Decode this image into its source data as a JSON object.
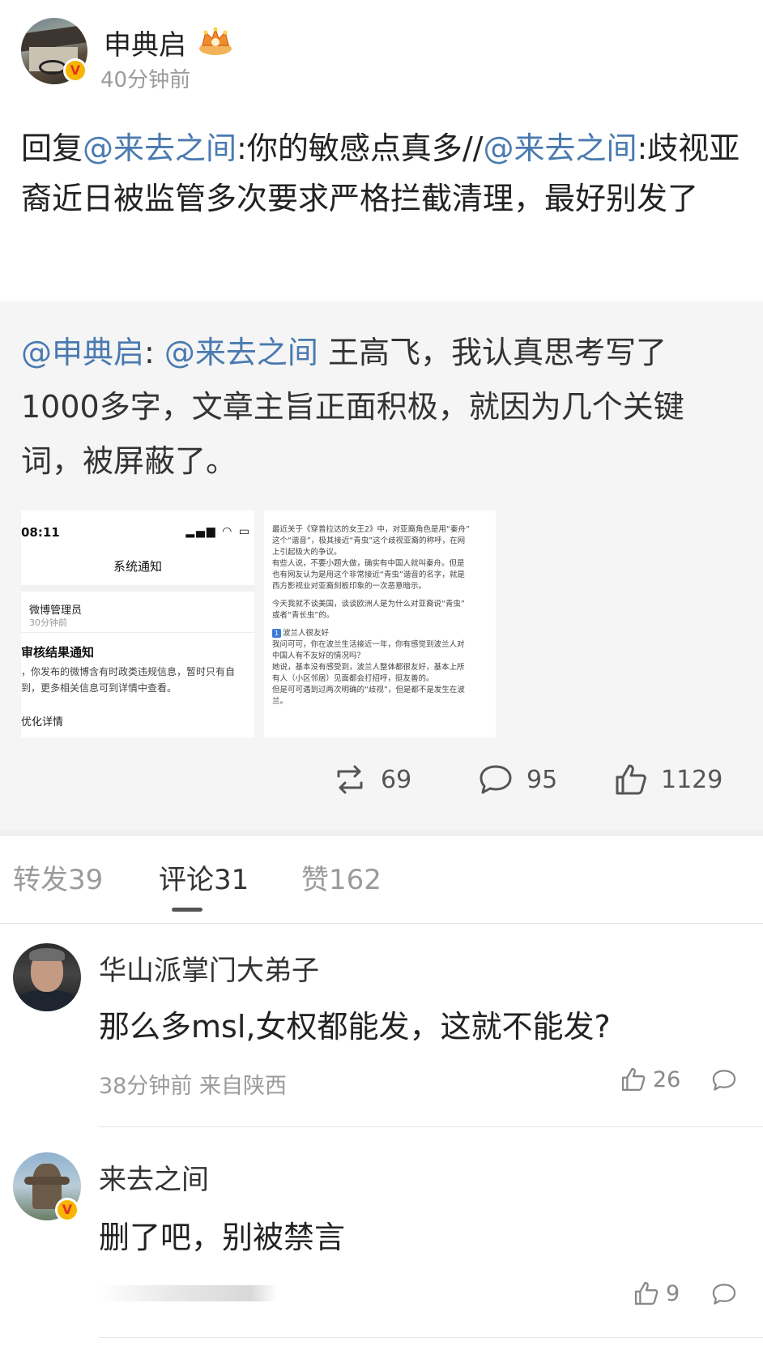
{
  "post": {
    "author": "申典启",
    "time": "40分钟前",
    "text": {
      "prefix": "回复",
      "mention1": "@来去之间",
      "mid": ":你的敏感点真多//",
      "mention2": "@来去之间",
      "rest": ":歧视亚裔近日被监管多次要求严格拦截清理，最好别发了"
    }
  },
  "repost": {
    "mention_author": "@申典启",
    "colon": ": ",
    "mention_target": "@来去之间",
    "text": " 王高飞，我认真思考写了1000多字，文章主旨正面积极，就因为几个关键词，被屏蔽了。",
    "thumb1": {
      "status_time": "08:11",
      "title": "系统通知",
      "admin_name": "微博管理员",
      "admin_time": "30分钟前",
      "result_title": "审核结果通知",
      "line1": "，你发布的微博含有时政类违规信息，暂时只有自",
      "line2": "到，更多相关信息可到详情中查看。",
      "optimize": "优化详情"
    },
    "thumb2": {
      "lines": [
        "最近关于《穿普拉达的女王2》中，对亚裔角色是用“秦舟”",
        "这个“谐音”，极其接近“青虫”这个歧视亚裔的称呼，在网",
        "上引起极大的争议。",
        "有些人说，不要小题大做，确实有中国人就叫秦舟。但是",
        "也有网友认为是用这个非常接近“青虫”谐音的名字，就是",
        "西方影视业对亚裔刻板印象的一次恶意暗示。",
        "",
        "今天我就不谈美国，谈谈欧洲人是为什么对亚裔说“青虫”",
        "或者“青长虫”的。",
        "",
        "波兰人很友好",
        "我问可可，你在波兰生活接近一年，你有感觉到波兰人对",
        "中国人有不友好的情况吗？",
        "她说，基本没有感受到，波兰人整体都很友好，基本上所",
        "有人（小区邻居）见面都会打招呼，挺友善的。",
        "但是可可遇到过两次明确的“歧视”，但是都不是发生在波",
        "兰。"
      ]
    },
    "reposts": "69",
    "comments": "95",
    "likes": "1129"
  },
  "tabs": {
    "forward": "转发39",
    "comments": "评论31",
    "likes": "赞162"
  },
  "comments": [
    {
      "name": "华山派掌门大弟子",
      "text": "那么多msl,女权都能发，这就不能发?",
      "meta": "38分钟前 来自陕西",
      "likes": "26"
    },
    {
      "name": "来去之间",
      "text": "删了吧，别被禁言",
      "likes": "9"
    }
  ],
  "icons": {
    "crown": "crown-badge-icon",
    "verified": "verified-v-icon",
    "repost": "repost-icon",
    "comment": "comment-icon",
    "like": "like-icon"
  },
  "colors": {
    "mention": "#4a7ab0",
    "verified_badge": "#f7b500",
    "verified_v": "#e0312a",
    "repost_bg": "#f5f5f5"
  }
}
